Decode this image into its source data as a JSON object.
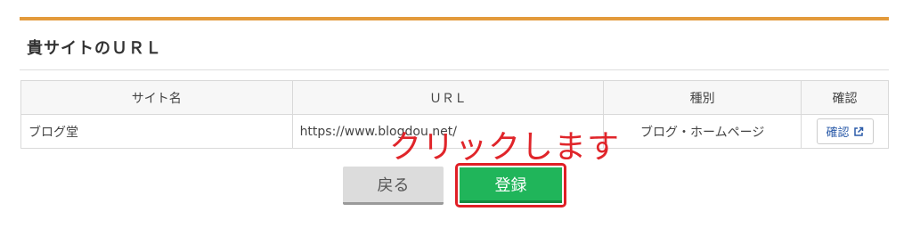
{
  "section": {
    "title": "貴サイトのＵＲＬ"
  },
  "table": {
    "headers": {
      "name": "サイト名",
      "url": "ＵＲＬ",
      "type": "種別",
      "confirm": "確認"
    },
    "rows": [
      {
        "name": "ブログ堂",
        "url": "https://www.blogdou.net/",
        "type": "ブログ・ホームページ",
        "confirm_label": "確認"
      }
    ]
  },
  "annotation": "クリックします",
  "buttons": {
    "back": "戻る",
    "register": "登録"
  },
  "colors": {
    "accent_rule": "#e39a3b",
    "register": "#20b55a",
    "highlight": "#e01f26",
    "annotation": "#e0252a"
  }
}
